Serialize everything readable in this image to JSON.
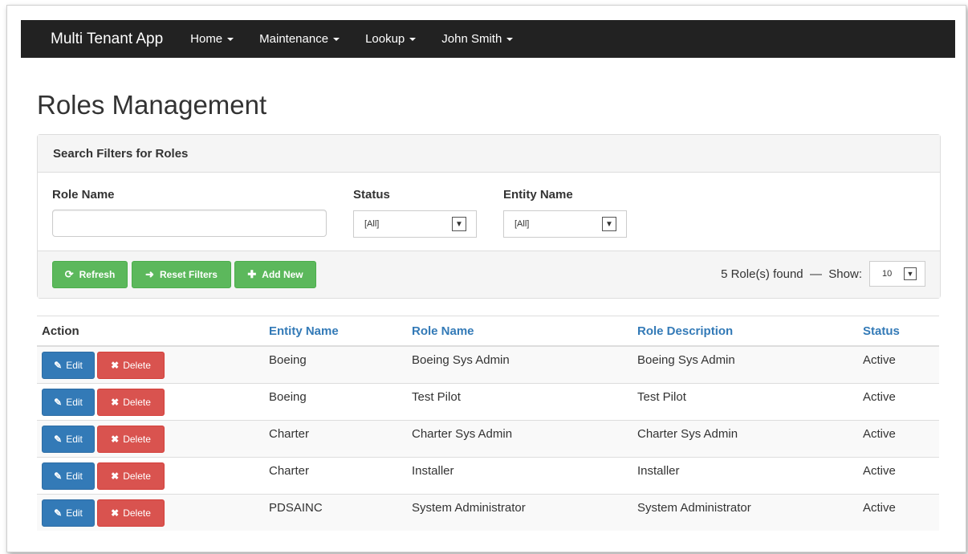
{
  "navbar": {
    "brand": "Multi Tenant App",
    "items": [
      {
        "label": "Home"
      },
      {
        "label": "Maintenance"
      },
      {
        "label": "Lookup"
      },
      {
        "label": "John Smith"
      }
    ]
  },
  "page_title": "Roles Management",
  "filters": {
    "heading": "Search Filters for Roles",
    "role_name_label": "Role Name",
    "role_name_value": "",
    "status_label": "Status",
    "status_value": "[All]",
    "entity_label": "Entity Name",
    "entity_value": "[All]"
  },
  "footer": {
    "refresh_label": "Refresh",
    "reset_label": "Reset Filters",
    "add_label": "Add New",
    "found_text": "5 Role(s) found  —  Show:",
    "show_value": "10"
  },
  "table": {
    "headers": [
      "Action",
      "Entity Name",
      "Role Name",
      "Role Description",
      "Status"
    ],
    "edit_label": "Edit",
    "delete_label": "Delete",
    "rows": [
      {
        "entity": "Boeing",
        "role": "Boeing Sys Admin",
        "description": "Boeing Sys Admin",
        "status": "Active"
      },
      {
        "entity": "Boeing",
        "role": "Test Pilot",
        "description": "Test Pilot",
        "status": "Active"
      },
      {
        "entity": "Charter",
        "role": "Charter Sys Admin",
        "description": "Charter Sys Admin",
        "status": "Active"
      },
      {
        "entity": "Charter",
        "role": "Installer",
        "description": "Installer",
        "status": "Active"
      },
      {
        "entity": "PDSAINC",
        "role": "System Administrator",
        "description": "System Administrator",
        "status": "Active"
      }
    ]
  },
  "colors": {
    "navbar": "#222222",
    "success": "#5cb85c",
    "primary": "#337ab7",
    "danger": "#d9534f"
  }
}
